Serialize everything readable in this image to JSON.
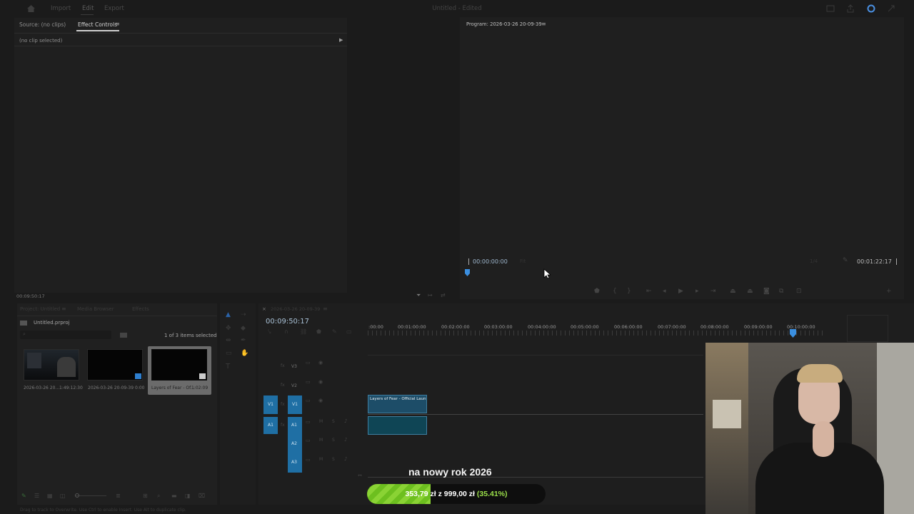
{
  "topbar": {
    "nav": [
      "Import",
      "Edit",
      "Export"
    ],
    "active_nav": "Edit",
    "title": "Untitled - Edited"
  },
  "source_panel": {
    "tab_source": "Source: (no clips)",
    "tab_effect_controls": "Effect Controls",
    "no_clip": "(no clip selected)",
    "timecode": "00:09:50:17"
  },
  "program_monitor": {
    "tab": "Program: 2026-03-26 20-09-39",
    "timecode_current": "00:00:00:00",
    "timecode_duration": "00:01:22:17"
  },
  "project_panel": {
    "tabs": [
      "Project: Untitled",
      "Media Browser",
      "Effects"
    ],
    "project_file": "Untitled.prproj",
    "selection_count": "1 of 3 items selected",
    "items": [
      {
        "name": "2026-03-26 20...",
        "duration": "1:49:12:30"
      },
      {
        "name": "2026-03-26 20-09-39",
        "duration": "0:00"
      },
      {
        "name": "Layers of Fear - Of...",
        "duration": "1:02:09"
      }
    ]
  },
  "timeline": {
    "sequence_tab": "2026-03-26 20-09-39",
    "timecode": "00:09:50:17",
    "ruler": [
      ":00:00",
      "00:01:00:00",
      "00:02:00:00",
      "00:03:00:00",
      "00:04:00:00",
      "00:05:00:00",
      "00:06:00:00",
      "00:07:00:00",
      "00:08:00:00",
      "00:09:00:00",
      "00:10:00:00"
    ],
    "video_tracks": [
      "V3",
      "V2",
      "V1"
    ],
    "audio_tracks": [
      "A1",
      "A2",
      "A3"
    ],
    "clip_label": "Layers of Fear - Official Laun"
  },
  "overlay": {
    "goal_title": "na nowy rok 2026",
    "goal_amount": "353,79 zł z 999,00 zł",
    "goal_percent": "(35.41%)",
    "goal_progress": 0.3541,
    "bar_color": "#6dbf1f"
  },
  "status_bar": {
    "hint": "Drag to track to Overwrite. Use Ctrl to enable Insert. Use Alt to duplicate clip."
  }
}
